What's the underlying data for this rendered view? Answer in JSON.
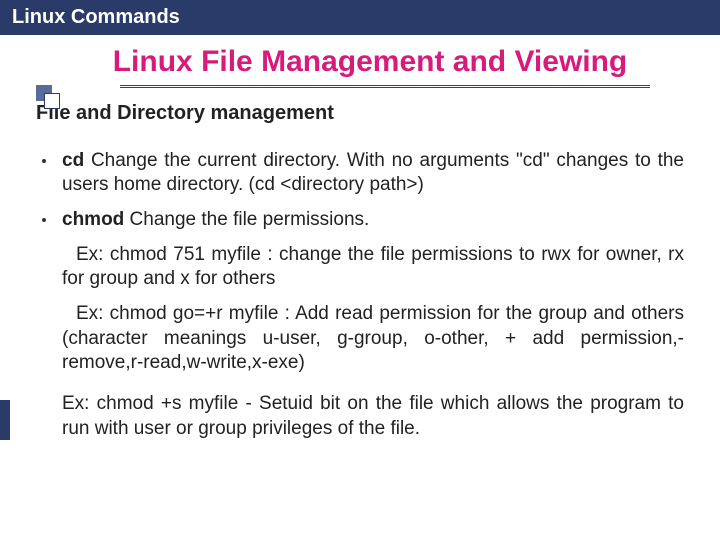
{
  "header": {
    "title": "Linux Commands"
  },
  "slide": {
    "title": "Linux File Management and Viewing",
    "subhead": "File and Directory management",
    "items": [
      {
        "cmd": "cd",
        "desc": " Change the current directory. With no arguments \"cd\" changes to the users home directory. (cd <directory path>)"
      },
      {
        "cmd": "chmod",
        "desc": " Change the file permissions."
      }
    ],
    "examples": [
      "Ex: chmod 751 myfile : change the file permissions to rwx for owner, rx for group and x for others",
      "Ex: chmod go=+r myfile : Add read permission for the group and others (character meanings u-user, g-group, o-other, + add permission,-remove,r-read,w-write,x-exe)",
      "Ex: chmod +s myfile - Setuid bit on the file which allows the program to run with user or group privileges of the file."
    ]
  }
}
